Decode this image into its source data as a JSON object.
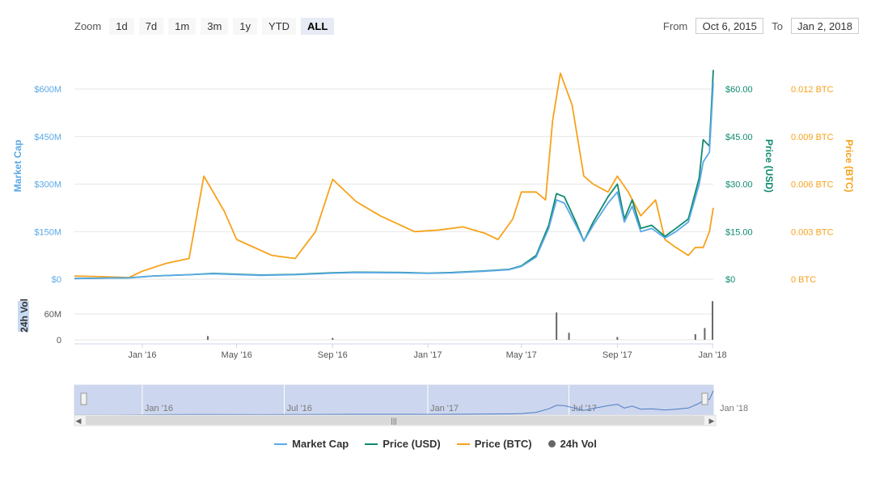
{
  "zoom": {
    "label": "Zoom",
    "buttons": [
      "1d",
      "7d",
      "1m",
      "3m",
      "1y",
      "YTD",
      "ALL"
    ],
    "active": "ALL"
  },
  "range": {
    "from_label": "From",
    "from_value": "Oct 6, 2015",
    "to_label": "To",
    "to_value": "Jan 2, 2018"
  },
  "legend": {
    "items": [
      {
        "label": "Market Cap",
        "color": "#5aa9e6"
      },
      {
        "label": "Price (USD)",
        "color": "#0f8a6e"
      },
      {
        "label": "Price (BTC)",
        "color": "#f7a21b"
      },
      {
        "label": "24h Vol",
        "color": "#666666"
      }
    ]
  },
  "chart_data": {
    "type": "line",
    "x_ticks": [
      "Jan '16",
      "May '16",
      "Sep '16",
      "Jan '17",
      "May '17",
      "Sep '17",
      "Jan '18"
    ],
    "navigator_ticks": [
      "Jan '16",
      "Jul '16",
      "Jan '17",
      "Jul '17",
      "Jan '18"
    ],
    "x_range": [
      "2015-10-06",
      "2018-01-02"
    ],
    "axes": {
      "market_cap": {
        "label": "Market Cap",
        "ticks": [
          "$0",
          "$150M",
          "$300M",
          "$450M",
          "$600M"
        ],
        "range": [
          0,
          600
        ],
        "color": "#5aa9e6"
      },
      "price_usd": {
        "label": "Price (USD)",
        "ticks": [
          "$0",
          "$15.00",
          "$30.00",
          "$45.00",
          "$60.00"
        ],
        "range": [
          0,
          60
        ],
        "color": "#0f8a6e"
      },
      "price_btc": {
        "label": "Price (BTC)",
        "ticks": [
          "0 BTC",
          "0.003 BTC",
          "0.006 BTC",
          "0.009 BTC",
          "0.012 BTC"
        ],
        "range": [
          0,
          0.012
        ],
        "color": "#f7a21b"
      },
      "volume": {
        "label": "24h Vol",
        "ticks": [
          "0",
          "60M"
        ],
        "range": [
          0,
          60
        ],
        "color": "#666666"
      }
    },
    "series": [
      {
        "name": "Market Cap",
        "unit": "$M",
        "axis": "market_cap",
        "points": [
          [
            "2015-10-06",
            2
          ],
          [
            "2015-12-15",
            4
          ],
          [
            "2016-01-15",
            10
          ],
          [
            "2016-03-01",
            14
          ],
          [
            "2016-04-01",
            17
          ],
          [
            "2016-06-01",
            12
          ],
          [
            "2016-07-15",
            14
          ],
          [
            "2016-09-01",
            19
          ],
          [
            "2016-10-01",
            21
          ],
          [
            "2016-12-01",
            20
          ],
          [
            "2017-01-01",
            18
          ],
          [
            "2017-02-01",
            20
          ],
          [
            "2017-03-15",
            25
          ],
          [
            "2017-04-15",
            30
          ],
          [
            "2017-05-01",
            40
          ],
          [
            "2017-05-20",
            70
          ],
          [
            "2017-06-05",
            160
          ],
          [
            "2017-06-15",
            250
          ],
          [
            "2017-06-25",
            240
          ],
          [
            "2017-07-10",
            170
          ],
          [
            "2017-07-20",
            120
          ],
          [
            "2017-08-01",
            170
          ],
          [
            "2017-08-20",
            240
          ],
          [
            "2017-09-01",
            275
          ],
          [
            "2017-09-10",
            180
          ],
          [
            "2017-09-20",
            230
          ],
          [
            "2017-10-01",
            150
          ],
          [
            "2017-10-15",
            160
          ],
          [
            "2017-11-01",
            130
          ],
          [
            "2017-11-15",
            150
          ],
          [
            "2017-12-01",
            180
          ],
          [
            "2017-12-15",
            300
          ],
          [
            "2017-12-20",
            370
          ],
          [
            "2017-12-28",
            400
          ],
          [
            "2018-01-02",
            620
          ]
        ]
      },
      {
        "name": "Price (USD)",
        "unit": "USD",
        "axis": "price_usd",
        "points": [
          [
            "2015-10-06",
            0.2
          ],
          [
            "2015-12-15",
            0.4
          ],
          [
            "2016-01-15",
            1.0
          ],
          [
            "2016-03-01",
            1.4
          ],
          [
            "2016-04-01",
            1.8
          ],
          [
            "2016-06-01",
            1.3
          ],
          [
            "2016-07-15",
            1.5
          ],
          [
            "2016-09-01",
            2.0
          ],
          [
            "2016-10-01",
            2.2
          ],
          [
            "2016-12-01",
            2.1
          ],
          [
            "2017-01-01",
            1.9
          ],
          [
            "2017-02-01",
            2.1
          ],
          [
            "2017-03-15",
            2.6
          ],
          [
            "2017-04-15",
            3.1
          ],
          [
            "2017-05-01",
            4.2
          ],
          [
            "2017-05-20",
            7.5
          ],
          [
            "2017-06-05",
            17
          ],
          [
            "2017-06-15",
            27
          ],
          [
            "2017-06-25",
            26
          ],
          [
            "2017-07-10",
            18
          ],
          [
            "2017-07-20",
            12
          ],
          [
            "2017-08-01",
            18
          ],
          [
            "2017-08-20",
            26
          ],
          [
            "2017-09-01",
            30
          ],
          [
            "2017-09-10",
            19
          ],
          [
            "2017-09-20",
            25
          ],
          [
            "2017-10-01",
            16
          ],
          [
            "2017-10-15",
            17
          ],
          [
            "2017-11-01",
            13.5
          ],
          [
            "2017-11-15",
            16
          ],
          [
            "2017-12-01",
            19
          ],
          [
            "2017-12-15",
            32
          ],
          [
            "2017-12-20",
            44
          ],
          [
            "2017-12-28",
            42
          ],
          [
            "2018-01-02",
            66
          ]
        ]
      },
      {
        "name": "Price (BTC)",
        "unit": "BTC",
        "axis": "price_btc",
        "points": [
          [
            "2015-10-06",
            0.0002
          ],
          [
            "2015-11-15",
            0.00015
          ],
          [
            "2015-12-15",
            0.0001
          ],
          [
            "2016-01-01",
            0.0005
          ],
          [
            "2016-02-01",
            0.001
          ],
          [
            "2016-03-01",
            0.0013
          ],
          [
            "2016-03-20",
            0.0065
          ],
          [
            "2016-04-15",
            0.0043
          ],
          [
            "2016-05-01",
            0.0025
          ],
          [
            "2016-06-15",
            0.0015
          ],
          [
            "2016-07-15",
            0.0013
          ],
          [
            "2016-08-10",
            0.003
          ],
          [
            "2016-09-01",
            0.0063
          ],
          [
            "2016-10-01",
            0.0049
          ],
          [
            "2016-11-01",
            0.004
          ],
          [
            "2016-12-15",
            0.003
          ],
          [
            "2017-01-15",
            0.0031
          ],
          [
            "2017-02-15",
            0.0033
          ],
          [
            "2017-03-15",
            0.0029
          ],
          [
            "2017-04-01",
            0.0025
          ],
          [
            "2017-04-20",
            0.0038
          ],
          [
            "2017-05-01",
            0.0055
          ],
          [
            "2017-05-20",
            0.0055
          ],
          [
            "2017-06-01",
            0.005
          ],
          [
            "2017-06-10",
            0.01
          ],
          [
            "2017-06-20",
            0.013
          ],
          [
            "2017-07-05",
            0.011
          ],
          [
            "2017-07-20",
            0.0065
          ],
          [
            "2017-08-01",
            0.006
          ],
          [
            "2017-08-20",
            0.0055
          ],
          [
            "2017-09-01",
            0.0065
          ],
          [
            "2017-09-15",
            0.0055
          ],
          [
            "2017-10-01",
            0.004
          ],
          [
            "2017-10-20",
            0.005
          ],
          [
            "2017-11-01",
            0.0025
          ],
          [
            "2017-11-15",
            0.002
          ],
          [
            "2017-12-01",
            0.0015
          ],
          [
            "2017-12-10",
            0.002
          ],
          [
            "2017-12-20",
            0.002
          ],
          [
            "2017-12-28",
            0.003
          ],
          [
            "2018-01-02",
            0.0045
          ]
        ]
      },
      {
        "name": "24h Vol",
        "unit": "$M",
        "axis": "volume",
        "points": [
          [
            "2016-03-25",
            8
          ],
          [
            "2016-09-01",
            4
          ],
          [
            "2017-06-15",
            58
          ],
          [
            "2017-07-01",
            15
          ],
          [
            "2017-09-01",
            6
          ],
          [
            "2017-12-10",
            12
          ],
          [
            "2017-12-22",
            25
          ],
          [
            "2018-01-01",
            82
          ]
        ]
      }
    ]
  }
}
